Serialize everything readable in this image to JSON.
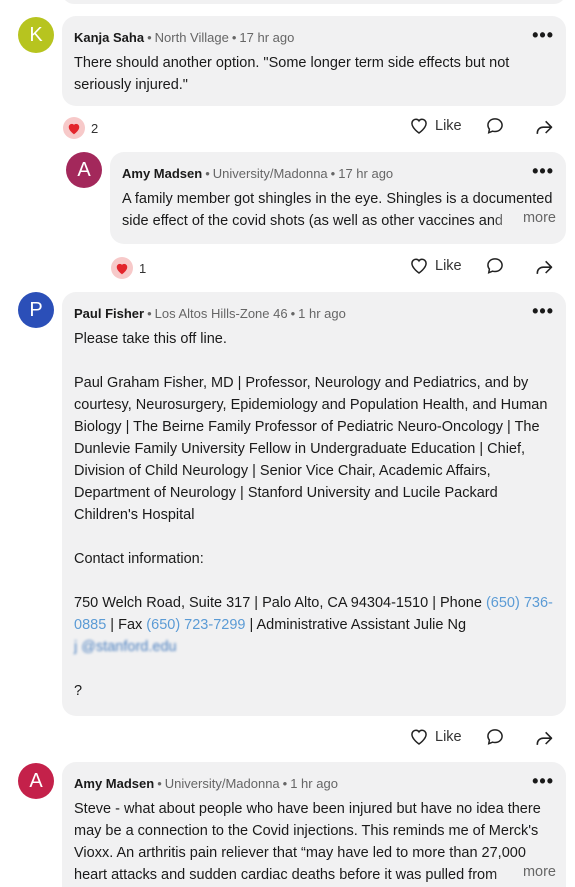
{
  "comments": [
    {
      "initial": "K",
      "avatar_color": "#b7c41f",
      "author": "Kanja Saha",
      "location": "North Village",
      "time": "17 hr ago",
      "lines": [
        "There should another option. \"Some longer term side effects but not",
        "seriously injured.\""
      ],
      "reaction_count": "2",
      "like_label": "Like"
    },
    {
      "initial": "A",
      "avatar_color": "#a3285b",
      "author": "Amy Madsen",
      "location": "University/Madonna",
      "time": "17 hr ago",
      "lines": [
        "A family member got shingles in the eye. Shingles is a documented",
        "side effect of the covid shots (as well as other vaccines and"
      ],
      "more_label": "more",
      "reaction_count": "1",
      "like_label": "Like"
    },
    {
      "initial": "P",
      "avatar_color": "#2b4fb8",
      "author": "Paul Fisher",
      "location": "Los Altos Hills-Zone 46",
      "time": "1 hr ago",
      "line1": "Please take this off line.",
      "sig": [
        "Paul Graham Fisher, MD | Professor, Neurology and Pediatrics, and by",
        "courtesy, Neurosurgery, Epidemiology and Population Health, and Human",
        "Biology | The Beirne Family Professor of Pediatric Neuro-Oncology | The",
        "Dunlevie Family University Fellow in Undergraduate Education | Chief,",
        "Division of Child Neurology | Senior Vice Chair, Academic Affairs,",
        "Department of Neurology | Stanford University and Lucile Packard",
        "Children's Hospital"
      ],
      "contact_heading": "Contact information:",
      "addr_prefix": "750 Welch Road, Suite 317 | Palo Alto, CA 94304-1510 | Phone ",
      "phone1_a": "(650) 736-",
      "phone1_b": "0885",
      "fax_prefix": " | Fax ",
      "fax": "(650) 723-7299",
      "assistant": " | Administrative Assistant Julie Ng",
      "email_blurred": "j    @stanford.edu",
      "question": "?",
      "like_label": "Like"
    },
    {
      "initial": "A",
      "avatar_color": "#c4214a",
      "author": "Amy Madsen",
      "location": "University/Madonna",
      "time": "1 hr ago",
      "lines": [
        "Steve - what about people who have been injured but have no idea there",
        "may be a connection to the Covid injections. This reminds me of Merck's",
        "Vioxx. An arthritis pain reliever that “may have led to more than 27,000",
        "heart attacks and sudden cardiac deaths before it was pulled from"
      ],
      "more_label": "more"
    }
  ],
  "icons": {
    "menu": "•••",
    "heart": "heart-icon",
    "like": "heart-outline-icon",
    "reply": "comment-icon",
    "share": "share-icon"
  }
}
